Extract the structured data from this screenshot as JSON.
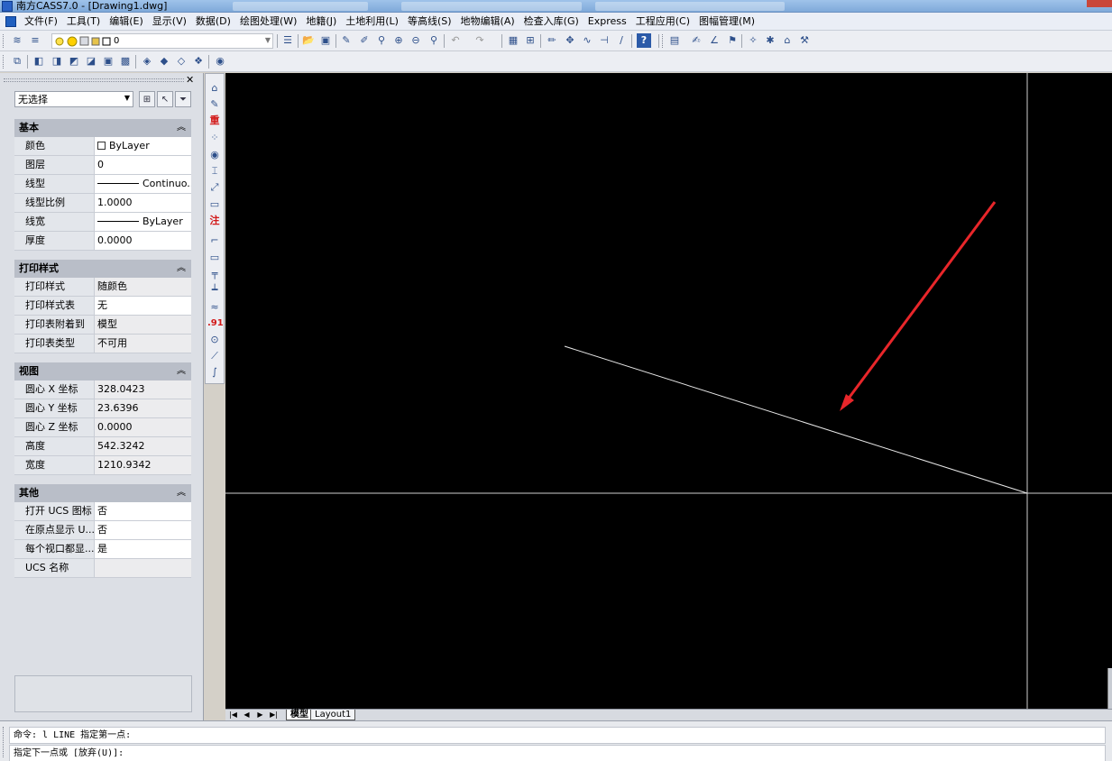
{
  "window": {
    "title": "南方CASS7.0 - [Drawing1.dwg]"
  },
  "menubar": {
    "items": [
      "文件(F)",
      "工具(T)",
      "编辑(E)",
      "显示(V)",
      "数据(D)",
      "绘图处理(W)",
      "地籍(J)",
      "土地利用(L)",
      "等高线(S)",
      "地物编辑(A)",
      "检查入库(G)",
      "Express",
      "工程应用(C)",
      "图幅管理(M)"
    ]
  },
  "toolbar": {
    "layer_value": "0",
    "icons": [
      "layers-icon",
      "layer-state-icon",
      "bulb-icon",
      "sun-icon",
      "lock-icon",
      "color-icon",
      "linetype-icon",
      "open-icon",
      "save-icon",
      "pencil-icon",
      "edit-icon",
      "zoom-window-icon",
      "zoom-in-icon",
      "zoom-out-icon",
      "undo-icon",
      "redo-icon",
      "properties-icon",
      "grid-icon",
      "draw-icon",
      "pan-icon",
      "snap-icon",
      "line-icon",
      "help-icon"
    ]
  },
  "palette": {
    "selection": "无选择",
    "sections": [
      {
        "title": "基本",
        "rows": [
          {
            "key": "颜色",
            "value": "ByLayer",
            "kind": "color"
          },
          {
            "key": "图层",
            "value": "0"
          },
          {
            "key": "线型",
            "value": "Continuo...",
            "kind": "linetype"
          },
          {
            "key": "线型比例",
            "value": "1.0000"
          },
          {
            "key": "线宽",
            "value": "ByLayer",
            "kind": "linetype"
          },
          {
            "key": "厚度",
            "value": "0.0000"
          }
        ]
      },
      {
        "title": "打印样式",
        "rows": [
          {
            "key": "打印样式",
            "value": "随颜色",
            "disabled": true
          },
          {
            "key": "打印样式表",
            "value": "无"
          },
          {
            "key": "打印表附着到",
            "value": "模型",
            "disabled": true
          },
          {
            "key": "打印表类型",
            "value": "不可用",
            "disabled": true
          }
        ]
      },
      {
        "title": "视图",
        "rows": [
          {
            "key": "圆心 X 坐标",
            "value": "328.0423",
            "disabled": true
          },
          {
            "key": "圆心 Y 坐标",
            "value": "23.6396",
            "disabled": true
          },
          {
            "key": "圆心 Z 坐标",
            "value": "0.0000",
            "disabled": true
          },
          {
            "key": "高度",
            "value": "542.3242",
            "disabled": true
          },
          {
            "key": "宽度",
            "value": "1210.9342",
            "disabled": true
          }
        ]
      },
      {
        "title": "其他",
        "rows": [
          {
            "key": "打开 UCS 图标",
            "value": "否"
          },
          {
            "key": "在原点显示 U...",
            "value": "否"
          },
          {
            "key": "每个视口都显...",
            "value": "是"
          },
          {
            "key": "UCS 名称",
            "value": "",
            "disabled": true
          }
        ]
      }
    ]
  },
  "vtoolbar": {
    "red_labels": [
      "重",
      "注",
      ".91"
    ]
  },
  "tabs": [
    "模型",
    "Layout1"
  ],
  "command": {
    "line1": "命令: l LINE 指定第一点:",
    "line2": "指定下一点或 [放弃(U)]:"
  },
  "colors": {
    "canvas_bg": "#000000",
    "crosshair": "#ffffff",
    "arrow": "#e8262a"
  }
}
